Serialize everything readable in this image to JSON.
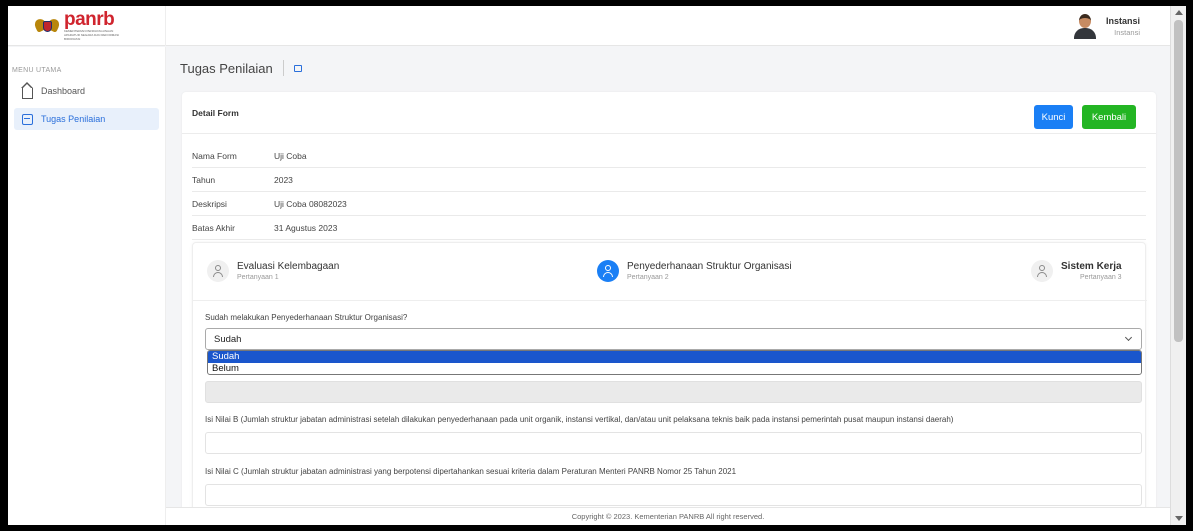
{
  "brand": {
    "name": "panrb",
    "subtitle": "KEMENTERIAN PENDAYAGUNAAN APARATUR NEGARA DAN REFORMASI BIROKRASI"
  },
  "user": {
    "name": "Instansi",
    "role": "Instansi"
  },
  "sidebar": {
    "heading": "MENU UTAMA",
    "items": [
      {
        "label": "Dashboard",
        "icon": "home-icon",
        "active": false
      },
      {
        "label": "Tugas Penilaian",
        "icon": "form-icon",
        "active": true
      }
    ]
  },
  "page": {
    "title": "Tugas Penilaian"
  },
  "card": {
    "title": "Detail Form",
    "buttons": {
      "kunci": "Kunci",
      "kembali": "Kembali"
    },
    "info": [
      {
        "key": "Nama Form",
        "value": "Uji Coba"
      },
      {
        "key": "Tahun",
        "value": "2023"
      },
      {
        "key": "Deskripsi",
        "value": "Uji Coba 08082023"
      },
      {
        "key": "Batas Akhir",
        "value": "31 Agustus 2023"
      }
    ]
  },
  "wizard": {
    "steps": [
      {
        "title": "Evaluasi Kelembagaan",
        "sub": "Pertanyaan 1",
        "active": false
      },
      {
        "title": "Penyederhanaan Struktur Organisasi",
        "sub": "Pertanyaan 2",
        "active": true
      },
      {
        "title": "Sistem Kerja",
        "sub": "Pertanyaan 3",
        "active": false
      }
    ],
    "question": "Sudah melakukan Penyederhanaan Struktur Organisasi?",
    "select_value": "Sudah",
    "options": [
      "Sudah",
      "Belum"
    ],
    "label_b": "Isi Nilai B (Jumlah struktur jabatan administrasi setelah dilakukan penyederhanaan pada unit organik, instansi vertikal, dan/atau unit pelaksana teknis baik pada instansi pemerintah pusat maupun instansi daerah)",
    "label_c": "Isi Nilai C (Jumlah struktur jabatan administrasi yang berpotensi dipertahankan sesuai kriteria dalam Peraturan Menteri PANRB Nomor 25 Tahun 2021"
  },
  "footer": "Copyright © 2023. Kementerian PANRB All right reserved.",
  "colors": {
    "primary": "#1a7ff5",
    "success": "#23b523",
    "brand": "#d0242e"
  }
}
